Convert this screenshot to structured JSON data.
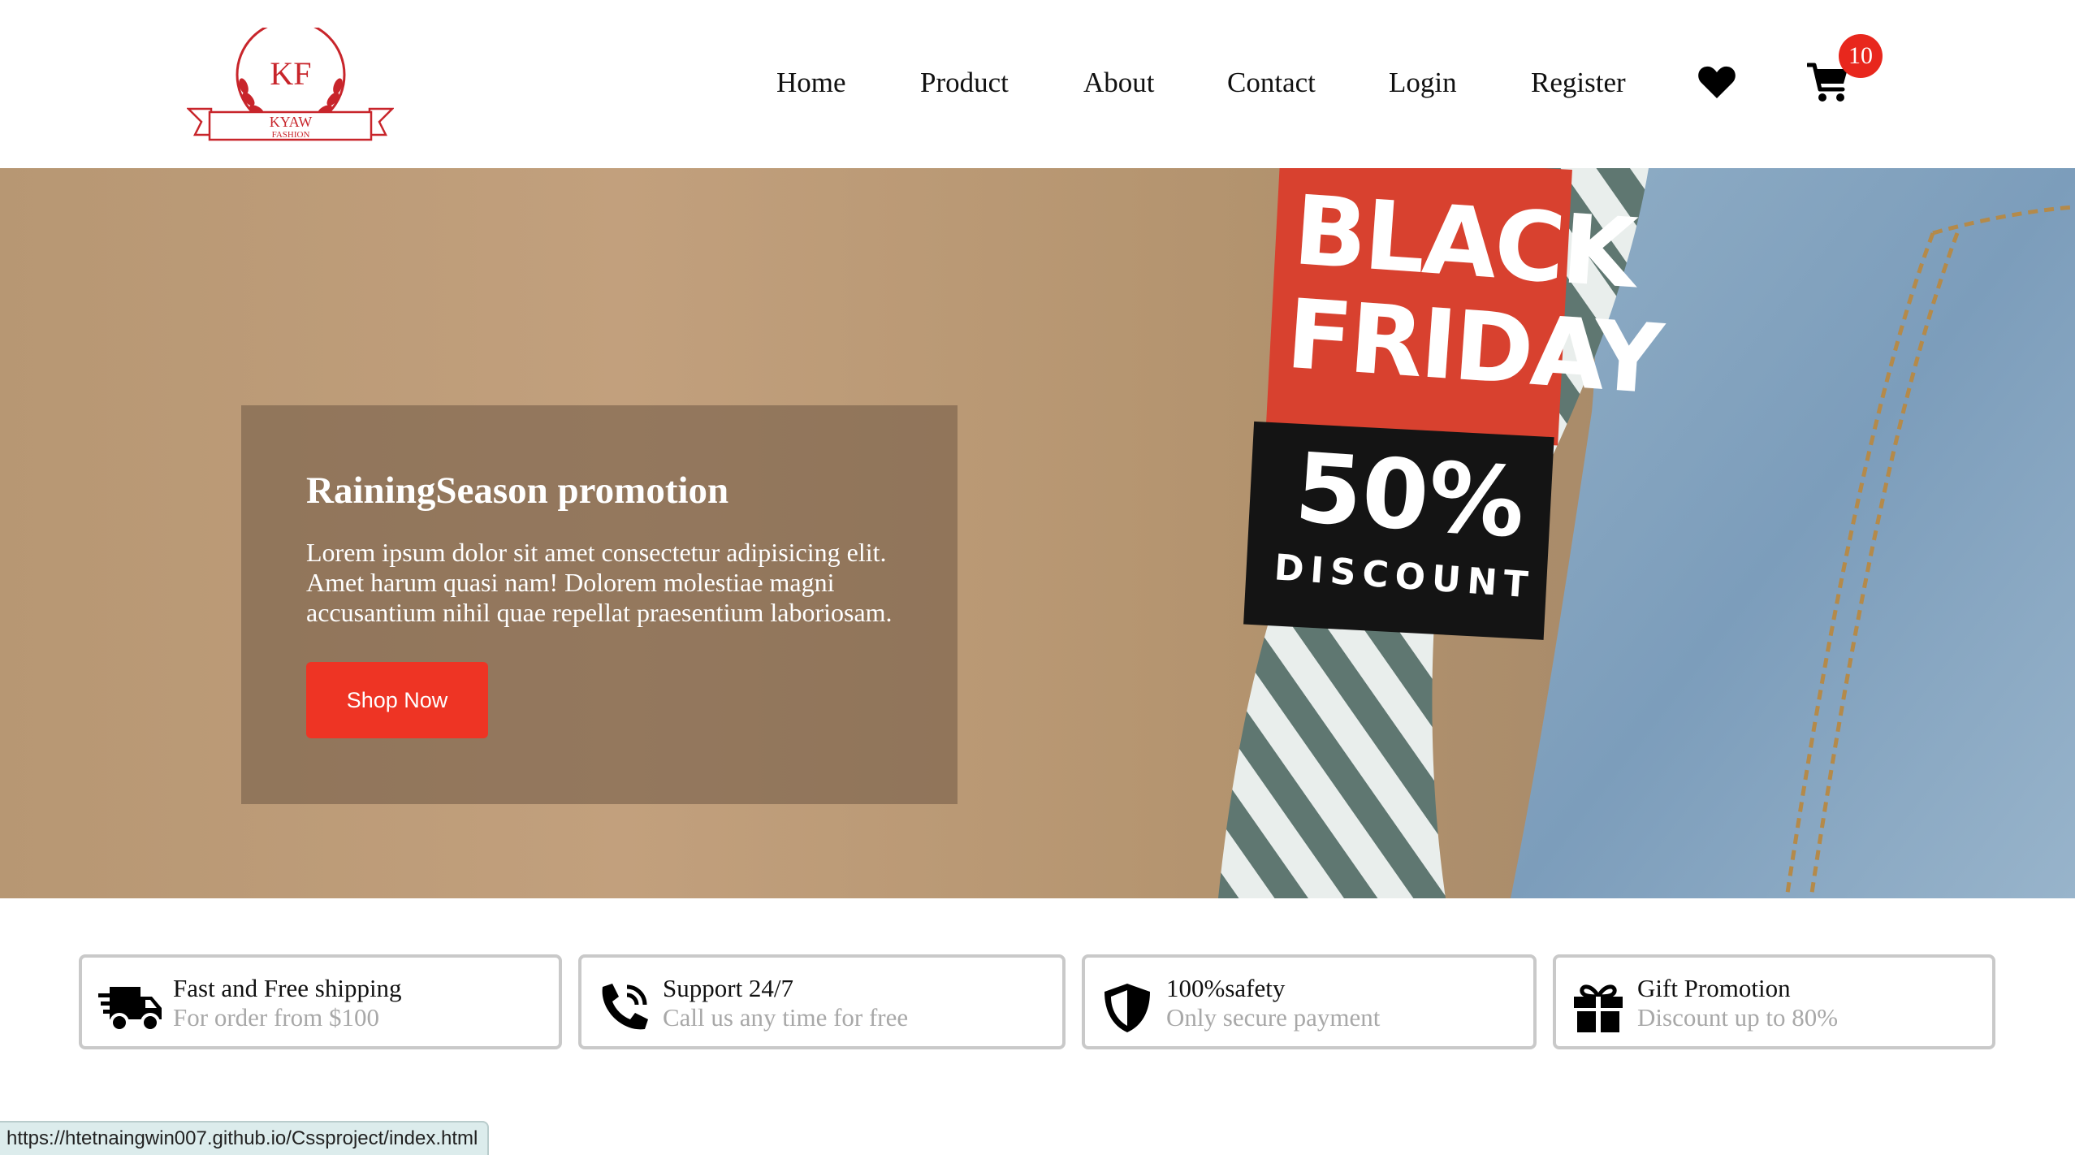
{
  "brand": {
    "monogram": "KF",
    "name": "KYAW",
    "tagline": "FASHION",
    "color": "#c8252b"
  },
  "nav": {
    "items": [
      {
        "label": "Home"
      },
      {
        "label": "Product"
      },
      {
        "label": "About"
      },
      {
        "label": "Contact"
      },
      {
        "label": "Login"
      },
      {
        "label": "Register"
      }
    ],
    "wishlist_icon": "heart-icon",
    "cart_icon": "cart-icon",
    "cart_count": "10"
  },
  "hero": {
    "tag_line1": "BLACK",
    "tag_line2": "FRIDAY",
    "tag_percent": "50%",
    "tag_discount": "DISCOUNT",
    "promo_title": "RainingSeason promotion",
    "promo_text": "Lorem ipsum dolor sit amet consectetur adipisicing elit. Amet harum quasi nam! Dolorem molestiae magni accusantium nihil quae repellat praesentium laboriosam.",
    "button_label": "Shop Now",
    "button_color": "#ee3424"
  },
  "features": [
    {
      "icon": "truck-fast-icon",
      "title": "Fast and Free shipping",
      "subtitle": "For order from $100"
    },
    {
      "icon": "phone-volume-icon",
      "title": "Support 24/7",
      "subtitle": "Call us any time for free"
    },
    {
      "icon": "shield-icon",
      "title": "100%safety",
      "subtitle": "Only secure payment"
    },
    {
      "icon": "gift-icon",
      "title": "Gift Promotion",
      "subtitle": "Discount up to 80%"
    }
  ],
  "status_bar": {
    "url": "https://htetnaingwin007.github.io/Cssproject/index.html"
  }
}
